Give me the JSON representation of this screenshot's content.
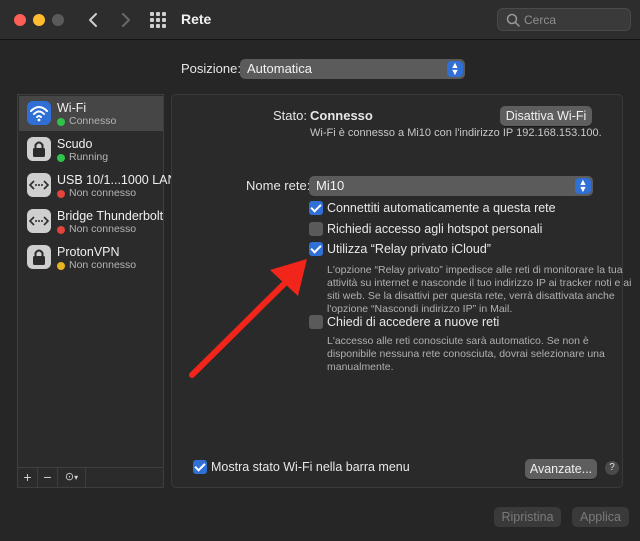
{
  "window": {
    "title": "Rete",
    "search": {
      "placeholder": "Cerca"
    }
  },
  "location": {
    "label": "Posizione:",
    "value": "Automatica"
  },
  "services": [
    {
      "name": "Wi-Fi",
      "status": "Connesso",
      "status_color": "#30c24a",
      "icon": "wifi-icon",
      "selected": true
    },
    {
      "name": "Scudo",
      "status": "Running",
      "status_color": "#30c24a",
      "icon": "lock-icon"
    },
    {
      "name": "USB 10/1...1000 LAN",
      "status": "Non connesso",
      "status_color": "#e0443a",
      "icon": "ethernet-icon"
    },
    {
      "name": "Bridge Thunderbolt",
      "status": "Non connesso",
      "status_color": "#e0443a",
      "icon": "ethernet-icon"
    },
    {
      "name": "ProtonVPN",
      "status": "Non connesso",
      "status_color": "#e6b422",
      "icon": "lock-icon"
    }
  ],
  "sidebar_footer": {
    "add": "+",
    "remove": "−",
    "action": "⊙"
  },
  "detail": {
    "status_label": "Stato:",
    "status_value": "Connesso",
    "toggle_button": "Disattiva Wi-Fi",
    "status_desc": "Wi-Fi è connesso a Mi10 con l'indirizzo IP 192.168.153.100.",
    "network_label": "Nome rete:",
    "network_value": "Mi10",
    "options": [
      {
        "label": "Connettiti automaticamente a questa rete",
        "checked": true
      },
      {
        "label": "Richiedi accesso agli hotspot personali",
        "checked": false
      },
      {
        "label": "Utilizza “Relay privato iCloud”",
        "checked": true
      },
      {
        "label": "Chiedi di accedere a nuove reti",
        "checked": false
      }
    ],
    "relay_desc": [
      "L'opzione “Relay privato” impedisce alle reti di monitorare la tua",
      "attività su internet e nasconde il tuo indirizzo IP ai tracker noti e ai",
      "siti web. Se la disattivi per questa rete, verrà disattivata anche",
      "l'opzione “Nascondi indirizzo IP” in Mail."
    ],
    "ask_desc": [
      "L'accesso alle reti conosciute sarà automatico. Se non è",
      "disponibile nessuna rete conosciuta, dovrai selezionare una",
      "manualmente."
    ],
    "menu_bar_option": {
      "label": "Mostra stato Wi-Fi nella barra menu",
      "checked": true
    },
    "advanced_button": "Avanzate...",
    "help": "?"
  },
  "footer": {
    "revert": "Ripristina",
    "apply": "Applica"
  },
  "colors": {
    "accent": "#2f6fd6",
    "annotation_arrow": "#f2251b"
  }
}
